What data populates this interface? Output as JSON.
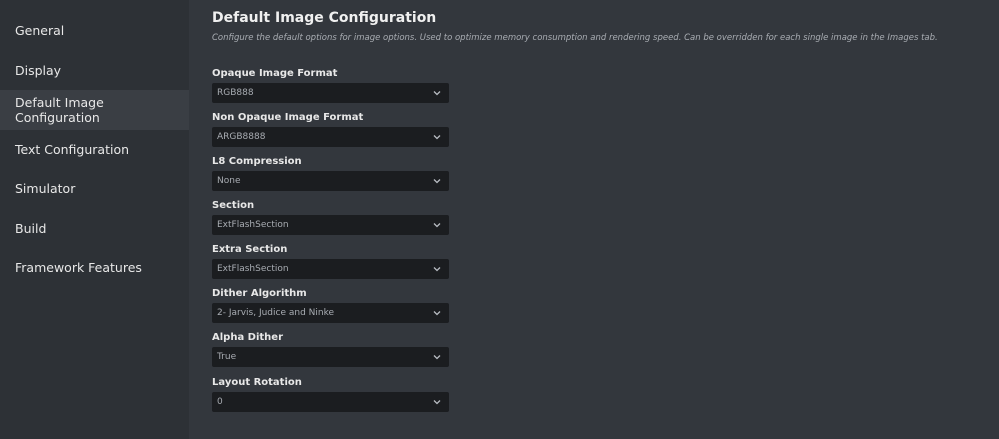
{
  "sidebar": {
    "items": [
      {
        "label": "General"
      },
      {
        "label": "Display"
      },
      {
        "label": "Default Image Configuration"
      },
      {
        "label": "Text Configuration"
      },
      {
        "label": "Simulator"
      },
      {
        "label": "Build"
      },
      {
        "label": "Framework Features"
      }
    ],
    "active_index": 2
  },
  "main": {
    "title": "Default Image Configuration",
    "subtitle": "Configure the default options for image options. Used to optimize memory consumption and rendering speed. Can be overridden for each single image in the Images tab.",
    "fields": [
      {
        "label": "Opaque Image Format",
        "value": "RGB888"
      },
      {
        "label": "Non Opaque Image Format",
        "value": "ARGB8888"
      },
      {
        "label": "L8 Compression",
        "value": "None"
      },
      {
        "label": "Section",
        "value": "ExtFlashSection"
      },
      {
        "label": "Extra Section",
        "value": "ExtFlashSection"
      },
      {
        "label": "Dither Algorithm",
        "value": "2- Jarvis, Judice and Ninke"
      },
      {
        "label": "Alpha Dither",
        "value": "True"
      },
      {
        "label": "Layout Rotation",
        "value": "0"
      }
    ]
  },
  "icons": {
    "dropdown": "chevron-down-icon"
  },
  "colors": {
    "background": "#33373d",
    "sidebar": "#2d3136",
    "sidebar_active": "#3a3e44",
    "select_bg": "#1b1d20"
  }
}
